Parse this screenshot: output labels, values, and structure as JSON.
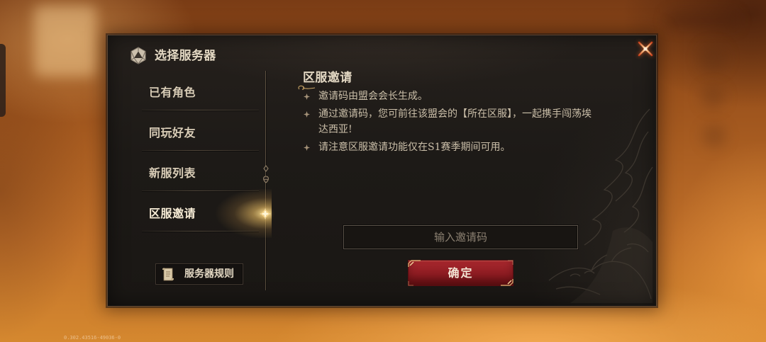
{
  "header": {
    "title": "选择服务器",
    "title_icon": "d20-dice-icon",
    "close_icon": "close-icon"
  },
  "sidebar": {
    "active_index": 3,
    "items": [
      {
        "label": "已有角色"
      },
      {
        "label": "同玩好友"
      },
      {
        "label": "新服列表"
      },
      {
        "label": "区服邀请"
      }
    ],
    "selected_marker_icon": "sparkle-diamond-icon",
    "rules_button": {
      "label": "服务器规则",
      "icon": "scroll-icon"
    }
  },
  "content": {
    "heading": "区服邀请",
    "bullet_icon": "four-point-star-icon",
    "bullets": [
      {
        "lines": [
          "邀请码由盟会会长生成。"
        ]
      },
      {
        "lines": [
          "通过邀请码，您可前往该盟会的【所在区服】，一起携手闯荡埃",
          "达西亚!"
        ]
      },
      {
        "lines": [
          "请注意区服邀请功能仅在S1赛季期间可用。"
        ]
      }
    ],
    "invite_input": {
      "value": "",
      "placeholder": "输入邀请码"
    },
    "confirm_button": {
      "label": "确定"
    }
  },
  "footer": {
    "version": "0.302.43516-49036-0"
  },
  "colors": {
    "panel_bg": "#1d1a17",
    "gold": "#c9a566",
    "text_primary": "#e3d8c3",
    "text_secondary": "#cbbfa9",
    "confirm_red": "#8e1c22",
    "placeholder": "#8b8071"
  }
}
